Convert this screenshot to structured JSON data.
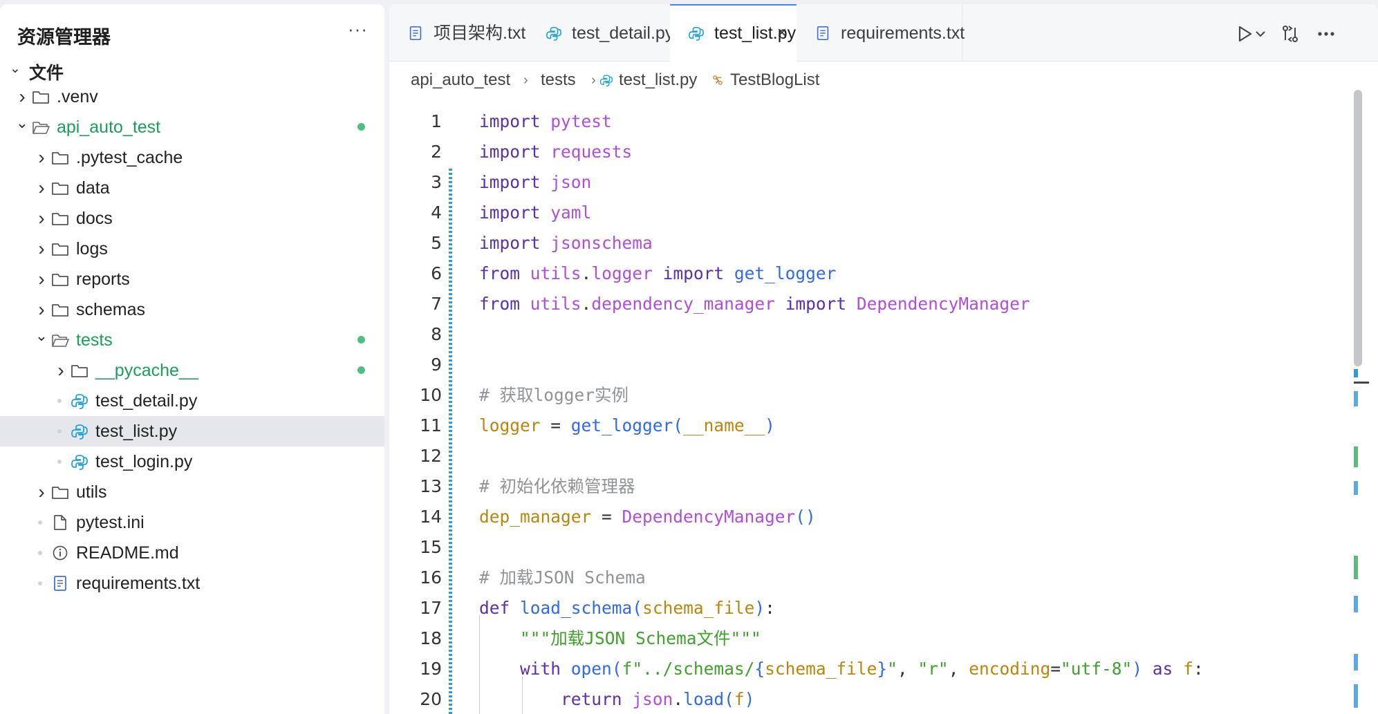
{
  "sidebar": {
    "title": "资源管理器",
    "more": "···",
    "root_label": "文件",
    "items": [
      {
        "label": ".venv",
        "type": "folder",
        "expanded": false,
        "level": 1
      },
      {
        "label": "api_auto_test",
        "type": "folder",
        "expanded": true,
        "level": 1,
        "modified": true
      },
      {
        "label": ".pytest_cache",
        "type": "folder",
        "expanded": false,
        "level": 2
      },
      {
        "label": "data",
        "type": "folder",
        "expanded": false,
        "level": 2
      },
      {
        "label": "docs",
        "type": "folder",
        "expanded": false,
        "level": 2
      },
      {
        "label": "logs",
        "type": "folder",
        "expanded": false,
        "level": 2
      },
      {
        "label": "reports",
        "type": "folder",
        "expanded": false,
        "level": 2
      },
      {
        "label": "schemas",
        "type": "folder",
        "expanded": false,
        "level": 2
      },
      {
        "label": "tests",
        "type": "folder",
        "expanded": true,
        "level": 2,
        "modified": true
      },
      {
        "label": "__pycache__",
        "type": "folder",
        "expanded": false,
        "level": 3,
        "modified": true
      },
      {
        "label": "test_detail.py",
        "type": "python",
        "level": 3
      },
      {
        "label": "test_list.py",
        "type": "python",
        "level": 3,
        "selected": true
      },
      {
        "label": "test_login.py",
        "type": "python",
        "level": 3
      },
      {
        "label": "utils",
        "type": "folder",
        "expanded": false,
        "level": 2
      },
      {
        "label": "pytest.ini",
        "type": "file",
        "level": 2
      },
      {
        "label": "README.md",
        "type": "info",
        "level": 2
      },
      {
        "label": "requirements.txt",
        "type": "text",
        "level": 2
      }
    ]
  },
  "tabs": [
    {
      "label": "项目架构.txt",
      "icon": "text-file-icon",
      "active": false
    },
    {
      "label": "test_detail.py",
      "icon": "python-icon",
      "active": false
    },
    {
      "label": "test_list.py",
      "icon": "python-icon",
      "active": true,
      "close": "×"
    },
    {
      "label": "requirements.txt",
      "icon": "text-file-icon",
      "active": false
    }
  ],
  "breadcrumb": {
    "segments": [
      "api_auto_test",
      "tests",
      "test_list.py",
      "TestBlogList"
    ],
    "separator": "›"
  },
  "code": {
    "lines": [
      {
        "n": "1",
        "tokens": [
          [
            "k",
            "import"
          ],
          [
            "o",
            " "
          ],
          [
            "m",
            "pytest"
          ]
        ]
      },
      {
        "n": "2",
        "tokens": [
          [
            "k",
            "import"
          ],
          [
            "o",
            " "
          ],
          [
            "m",
            "requests"
          ]
        ]
      },
      {
        "n": "3",
        "tokens": [
          [
            "k",
            "import"
          ],
          [
            "o",
            " "
          ],
          [
            "m",
            "json"
          ]
        ]
      },
      {
        "n": "4",
        "tokens": [
          [
            "k",
            "import"
          ],
          [
            "o",
            " "
          ],
          [
            "m",
            "yaml"
          ]
        ]
      },
      {
        "n": "5",
        "tokens": [
          [
            "k",
            "import"
          ],
          [
            "o",
            " "
          ],
          [
            "m",
            "jsonschema"
          ]
        ]
      },
      {
        "n": "6",
        "tokens": [
          [
            "k",
            "from"
          ],
          [
            "o",
            " "
          ],
          [
            "m",
            "utils"
          ],
          [
            "o",
            "."
          ],
          [
            "m",
            "logger"
          ],
          [
            "o",
            " "
          ],
          [
            "k",
            "import"
          ],
          [
            "o",
            " "
          ],
          [
            "f",
            "get_logger"
          ]
        ]
      },
      {
        "n": "7",
        "tokens": [
          [
            "k",
            "from"
          ],
          [
            "o",
            " "
          ],
          [
            "m",
            "utils"
          ],
          [
            "o",
            "."
          ],
          [
            "m",
            "dependency_manager"
          ],
          [
            "o",
            " "
          ],
          [
            "k",
            "import"
          ],
          [
            "o",
            " "
          ],
          [
            "m",
            "DependencyManager"
          ]
        ]
      },
      {
        "n": "8",
        "tokens": []
      },
      {
        "n": "9",
        "tokens": []
      },
      {
        "n": "10",
        "tokens": [
          [
            "c",
            "# 获取logger实例"
          ]
        ]
      },
      {
        "n": "11",
        "tokens": [
          [
            "v",
            "logger"
          ],
          [
            "o",
            " = "
          ],
          [
            "f",
            "get_logger"
          ],
          [
            "p",
            "("
          ],
          [
            "v",
            "__name__"
          ],
          [
            "p",
            ")"
          ]
        ]
      },
      {
        "n": "12",
        "tokens": []
      },
      {
        "n": "13",
        "tokens": [
          [
            "c",
            "# 初始化依赖管理器"
          ]
        ]
      },
      {
        "n": "14",
        "tokens": [
          [
            "v",
            "dep_manager"
          ],
          [
            "o",
            " = "
          ],
          [
            "m",
            "DependencyManager"
          ],
          [
            "p",
            "()"
          ]
        ]
      },
      {
        "n": "15",
        "tokens": []
      },
      {
        "n": "16",
        "tokens": [
          [
            "c",
            "# 加载JSON Schema"
          ]
        ]
      },
      {
        "n": "17",
        "tokens": [
          [
            "k",
            "def"
          ],
          [
            "o",
            " "
          ],
          [
            "f",
            "load_schema"
          ],
          [
            "p",
            "("
          ],
          [
            "v",
            "schema_file"
          ],
          [
            "p",
            ")"
          ],
          [
            "o",
            ":"
          ]
        ]
      },
      {
        "n": "18",
        "tokens": [
          [
            "o",
            "    "
          ],
          [
            "s",
            "\"\"\"加载JSON Schema文件\"\"\""
          ]
        ]
      },
      {
        "n": "19",
        "tokens": [
          [
            "o",
            "    "
          ],
          [
            "k",
            "with"
          ],
          [
            "o",
            " "
          ],
          [
            "f",
            "open"
          ],
          [
            "p",
            "("
          ],
          [
            "s",
            "f\"../schemas/"
          ],
          [
            "p",
            "{"
          ],
          [
            "v",
            "schema_file"
          ],
          [
            "p",
            "}"
          ],
          [
            "s",
            "\""
          ],
          [
            "o",
            ", "
          ],
          [
            "s",
            "\"r\""
          ],
          [
            "o",
            ", "
          ],
          [
            "v",
            "encoding"
          ],
          [
            "o",
            "="
          ],
          [
            "s",
            "\"utf-8\""
          ],
          [
            "p",
            ")"
          ],
          [
            "o",
            " "
          ],
          [
            "k",
            "as"
          ],
          [
            "o",
            " "
          ],
          [
            "v",
            "f"
          ],
          [
            "o",
            ":"
          ]
        ]
      },
      {
        "n": "20",
        "tokens": [
          [
            "o",
            "        "
          ],
          [
            "k",
            "return"
          ],
          [
            "o",
            " "
          ],
          [
            "m",
            "json"
          ],
          [
            "o",
            "."
          ],
          [
            "f",
            "load"
          ],
          [
            "p",
            "("
          ],
          [
            "v",
            "f"
          ],
          [
            "p",
            ")"
          ]
        ]
      }
    ]
  },
  "colors": {
    "accent": "#3d84ff",
    "modified_dot": "#4cc082",
    "folder_green": "#1a9f59",
    "keyword": "#5a2fb0",
    "module": "#b04ddd",
    "function": "#2f6ae8",
    "variable": "#b8860b",
    "string": "#3ea12a",
    "comment": "#8f9297"
  }
}
